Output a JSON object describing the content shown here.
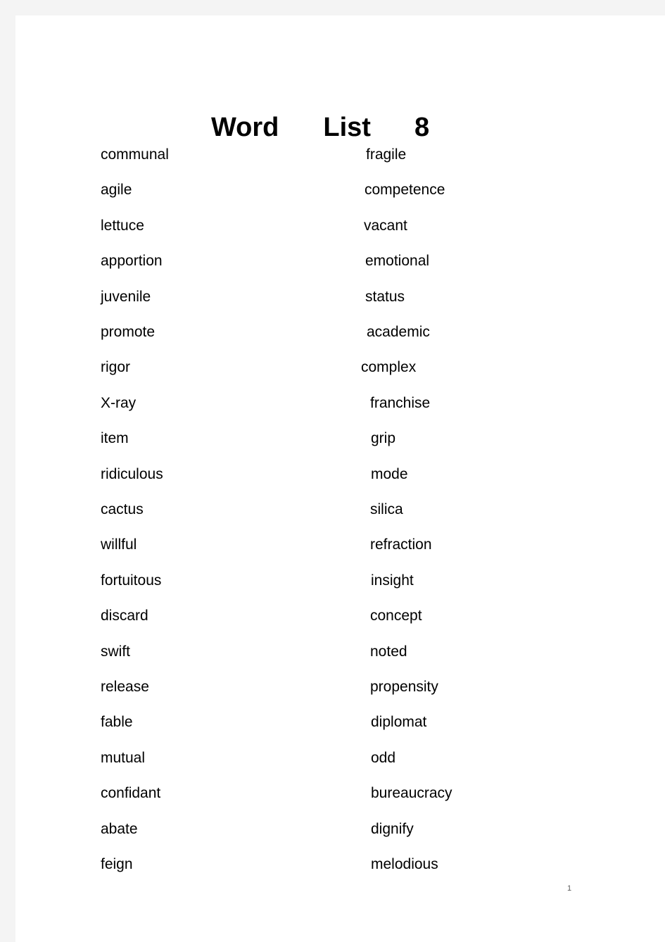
{
  "page": {
    "background_color": "#f4f4f4",
    "sheet_color": "#ffffff",
    "text_color": "#000000"
  },
  "title": {
    "word1": "Word",
    "word2": "List",
    "word3": "8",
    "full": "Word    List    8"
  },
  "columns": {
    "left_heading": "",
    "right_heading": ""
  },
  "rows": [
    {
      "left": "communal",
      "right": "fragile"
    },
    {
      "left": "agile",
      "right": "competence"
    },
    {
      "left": "lettuce",
      "right": "vacant"
    },
    {
      "left": "apportion",
      "right": "emotional"
    },
    {
      "left": "juvenile",
      "right": "status"
    },
    {
      "left": "promote",
      "right": "academic"
    },
    {
      "left": "rigor",
      "right": "complex"
    },
    {
      "left": "X-ray",
      "right": "franchise"
    },
    {
      "left": "item",
      "right": "grip"
    },
    {
      "left": "ridiculous",
      "right": "mode"
    },
    {
      "left": "cactus",
      "right": "silica"
    },
    {
      "left": "willful",
      "right": "refraction"
    },
    {
      "left": "fortuitous",
      "right": "insight"
    },
    {
      "left": "discard",
      "right": "concept"
    },
    {
      "left": "swift",
      "right": "noted"
    },
    {
      "left": "release",
      "right": "propensity"
    },
    {
      "left": "fable",
      "right": "diplomat"
    },
    {
      "left": "mutual",
      "right": "odd"
    },
    {
      "left": "confidant",
      "right": "bureaucracy"
    },
    {
      "left": "abate",
      "right": "dignify"
    },
    {
      "left": "feign",
      "right": "melodious"
    }
  ],
  "footer": {
    "page_number": "1"
  }
}
